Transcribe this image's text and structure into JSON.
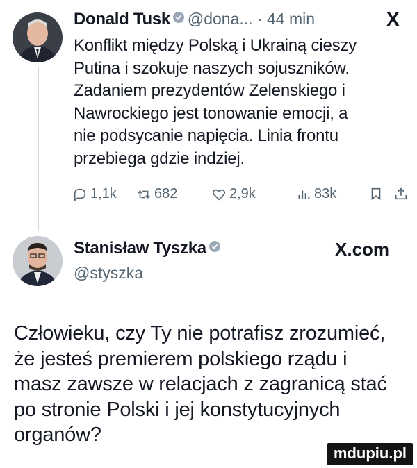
{
  "tweet": {
    "author_name": "Donald Tusk",
    "handle_time": "@dona... · 44 min",
    "x_logo": "X",
    "text_lines": [
      "Konflikt między Polską i Ukrainą cieszy",
      "Putina i szokuje naszych sojuszników.",
      "Zadaniem prezydentów Zelenskiego i",
      "Nawrockiego jest tonowanie emocji, a",
      "nie podsycanie napięcia. Linia frontu",
      "przebiega gdzie indziej."
    ],
    "actions": {
      "replies": "1,1k",
      "reposts": "682",
      "likes": "2,9k",
      "views": "83k"
    }
  },
  "quote": {
    "author_name": "Stanisław Tyszka",
    "handle": "@styszka",
    "source": "X.com",
    "text_lines": [
      "Człowieku, czy Ty nie potrafisz zrozumieć,",
      "że jesteś premierem polskiego rządu i",
      "masz zawsze w relacjach z zagranicą stać",
      "po stronie Polski i jej konstytucyjnych",
      "organów?"
    ]
  },
  "watermark": "mdupiu.pl",
  "colors": {
    "text": "#141823",
    "muted": "#536471",
    "verified": "#9aa7b4",
    "thread_line": "#cfd9de"
  },
  "icons": [
    "reply-icon",
    "repost-icon",
    "like-icon",
    "views-icon",
    "bookmark-icon",
    "share-icon",
    "verified-icon"
  ]
}
